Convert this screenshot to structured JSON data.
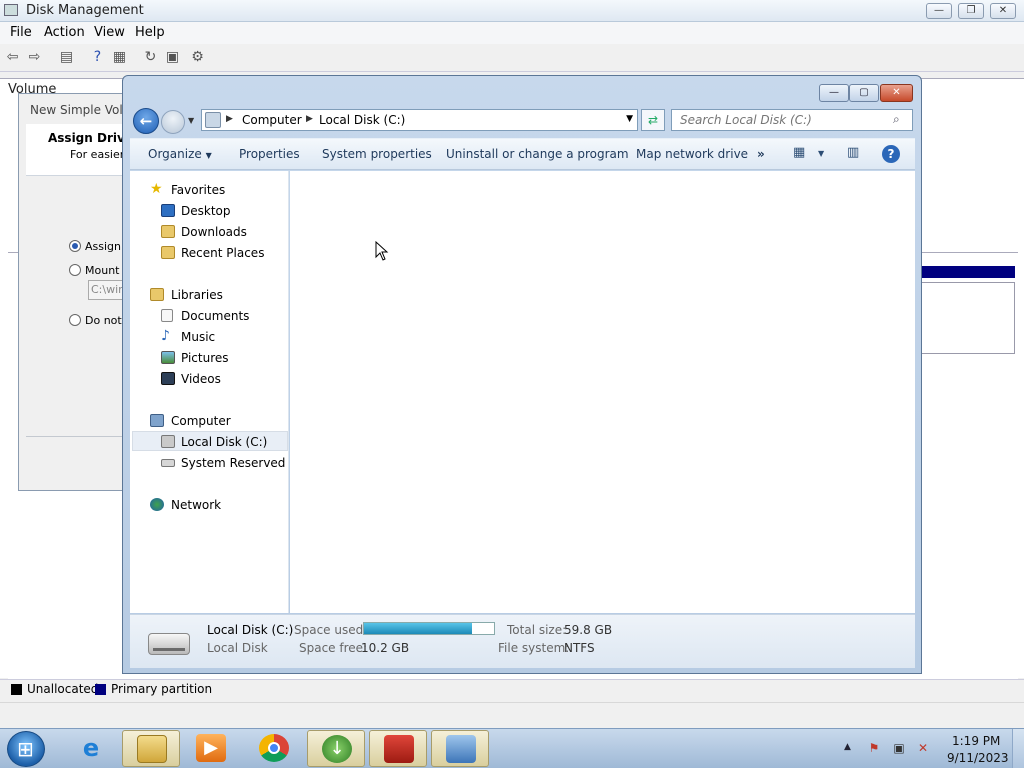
{
  "disk_management": {
    "title": "Disk Management",
    "menu": [
      "File",
      "Action",
      "View",
      "Help"
    ],
    "column_header": "Volume",
    "legend": [
      {
        "label": "Unallocated",
        "color": "#000000"
      },
      {
        "label": "Primary partition",
        "color": "#00007f"
      }
    ]
  },
  "wizard": {
    "title": "New Simple Volu",
    "heading": "Assign Drive",
    "subheading": "For easier a",
    "option1": "Assign t",
    "option2": "Mount i",
    "option3": "Do not a",
    "path_value": "C:\\win"
  },
  "explorer": {
    "breadcrumb": [
      "Computer",
      "Local Disk (C:)"
    ],
    "search_placeholder": "Search Local Disk (C:)",
    "commands": {
      "organize": "Organize",
      "properties": "Properties",
      "system_properties": "System properties",
      "uninstall": "Uninstall or change a program",
      "map_drive": "Map network drive",
      "more": "»"
    },
    "nav": {
      "favorites": "Favorites",
      "desktop": "Desktop",
      "downloads": "Downloads",
      "recent": "Recent Places",
      "libraries": "Libraries",
      "documents": "Documents",
      "music": "Music",
      "pictures": "Pictures",
      "videos": "Videos",
      "computer": "Computer",
      "local_disk": "Local Disk (C:)",
      "system_reserved": "System Reserved (E:)",
      "network": "Network"
    },
    "details": {
      "name": "Local Disk (C:)",
      "type": "Local Disk",
      "space_used_label": "Space used:",
      "space_free_label": "Space free:",
      "space_free": "10.2 GB",
      "total_size_label": "Total size:",
      "total_size": "59.8 GB",
      "fs_label": "File system:",
      "fs": "NTFS",
      "used_fraction": 0.83
    }
  },
  "taskbar": {
    "time": "1:19 PM",
    "date": "9/11/2023",
    "apps": [
      "start-button",
      "internet-explorer",
      "windows-explorer",
      "media-player",
      "chrome",
      "download-manager",
      "toolbox",
      "control-panel"
    ]
  }
}
